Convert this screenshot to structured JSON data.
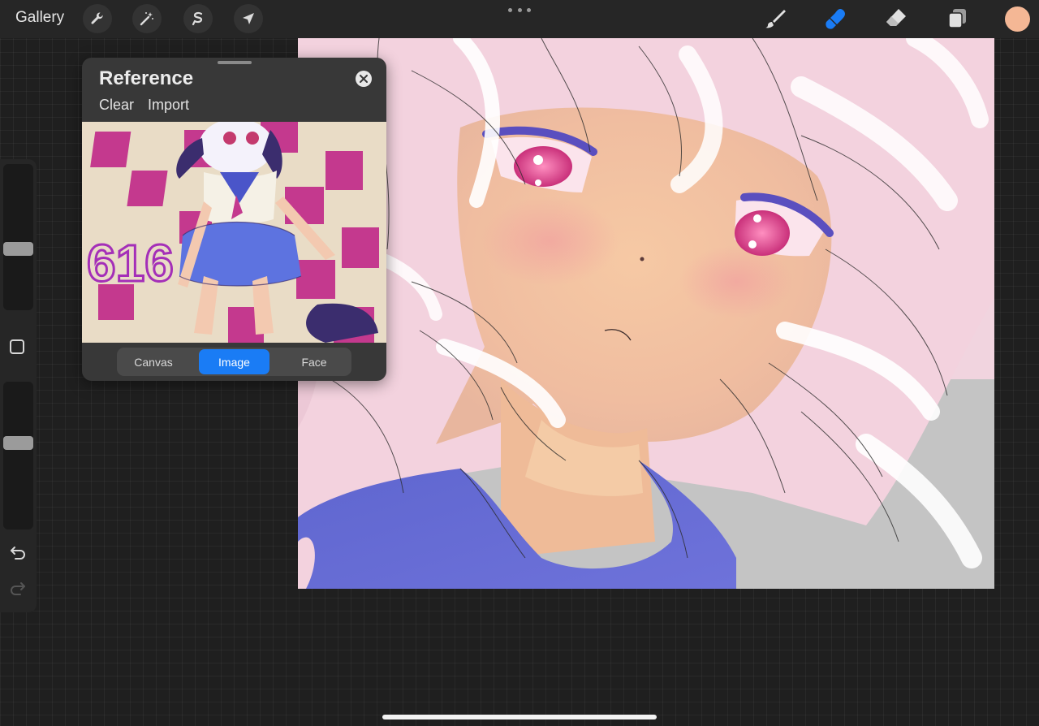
{
  "topbar": {
    "gallery_label": "Gallery",
    "left_tools": [
      "wrench-icon",
      "magic-wand-icon",
      "selection-icon",
      "transform-arrow-icon"
    ],
    "right_tools": [
      "brush-icon",
      "smudge-icon",
      "eraser-icon",
      "layers-icon"
    ],
    "active_tool": "smudge-icon",
    "current_color": "#f4b795",
    "accent_color": "#1a7cf5"
  },
  "sidebar": {
    "brush_size_level": 0.42,
    "opacity_level": 0.41
  },
  "reference": {
    "title": "Reference",
    "clear_label": "Clear",
    "import_label": "Import",
    "image_text": "616",
    "tabs": [
      "Canvas",
      "Image",
      "Face"
    ],
    "active_tab": "Image"
  }
}
